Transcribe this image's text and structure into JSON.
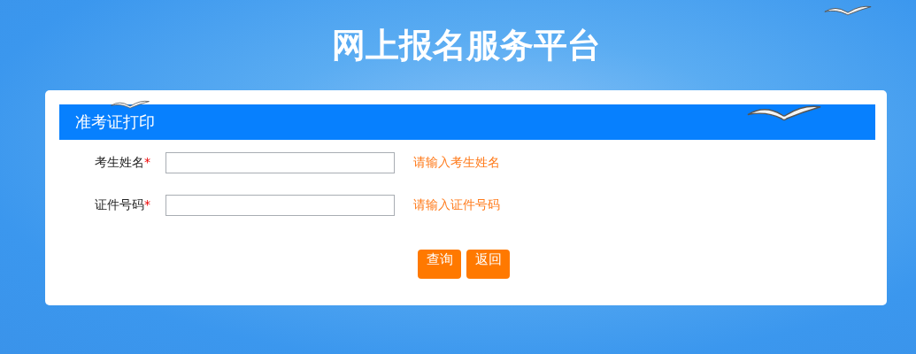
{
  "page_title": "网上报名服务平台",
  "panel": {
    "title": "准考证打印",
    "fields": [
      {
        "label": "考生姓名",
        "required_mark": "*",
        "hint": "请输入考生姓名"
      },
      {
        "label": "证件号码",
        "required_mark": "*",
        "hint": "请输入证件号码"
      }
    ],
    "buttons": [
      "查询",
      "返回"
    ]
  }
}
